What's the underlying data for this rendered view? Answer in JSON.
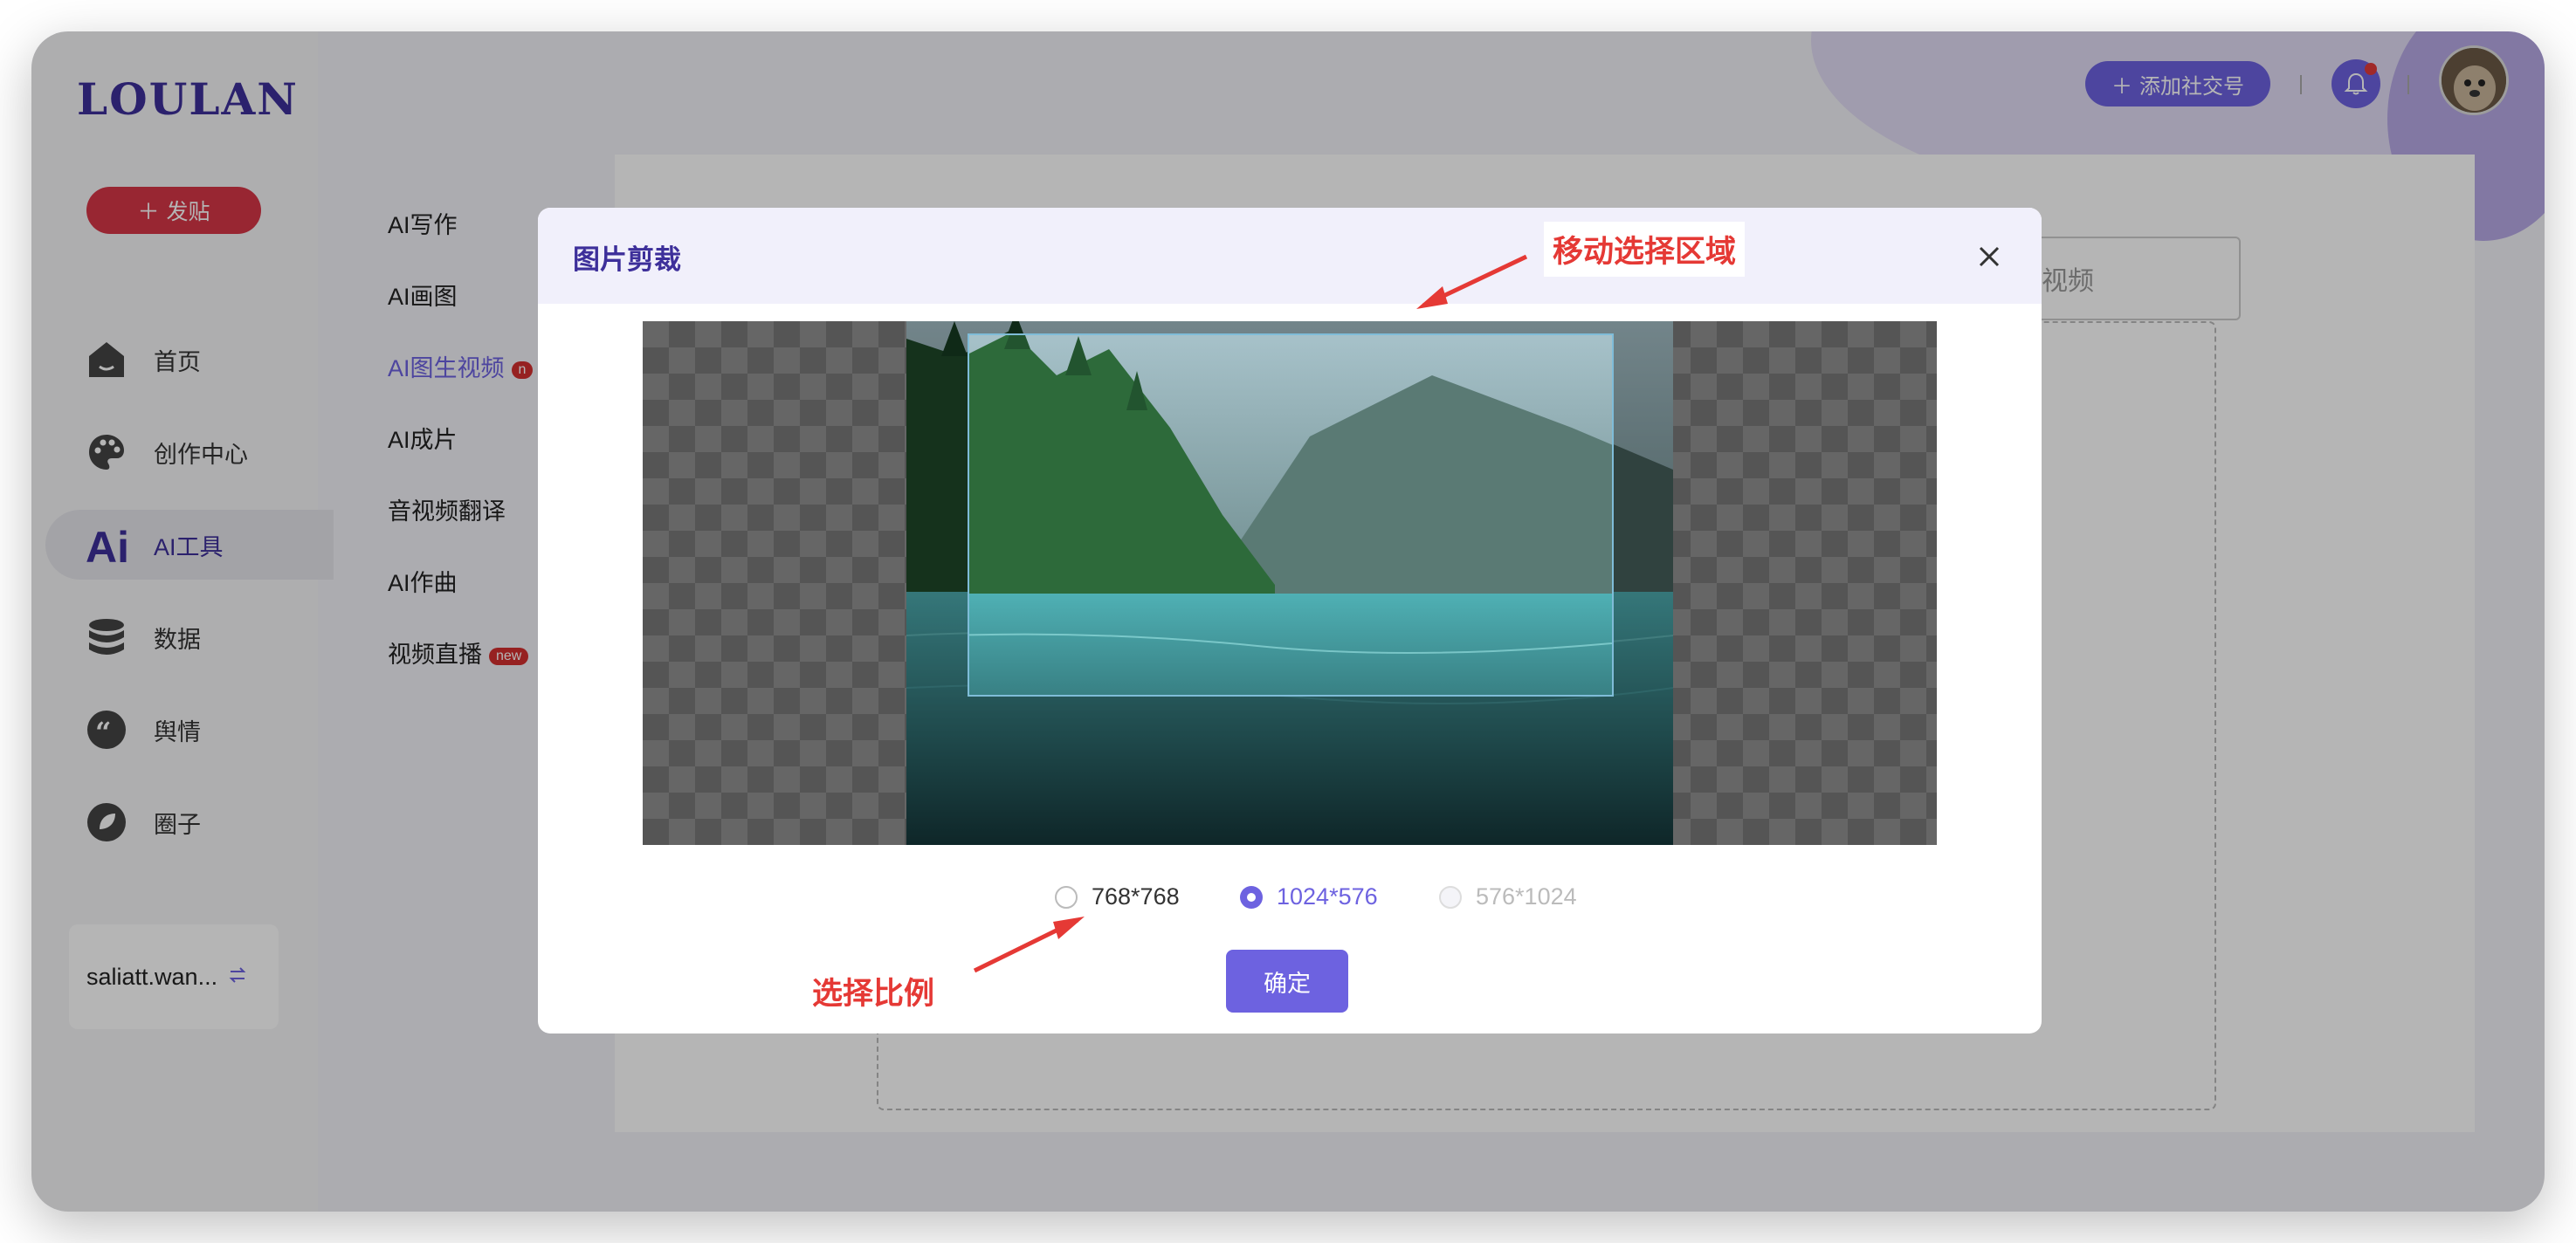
{
  "brand": {
    "logo": "LOULAN"
  },
  "sidebar": {
    "post_button": "发贴",
    "items": [
      {
        "label": "首页",
        "icon": "home-icon"
      },
      {
        "label": "创作中心",
        "icon": "palette-icon"
      },
      {
        "label": "AI工具",
        "icon": "ai-icon",
        "active": true
      },
      {
        "label": "数据",
        "icon": "database-icon"
      },
      {
        "label": "舆情",
        "icon": "quote-icon"
      },
      {
        "label": "圈子",
        "icon": "leaf-icon"
      }
    ],
    "user": {
      "name": "saliatt.wan..."
    }
  },
  "topbar": {
    "add_social": "添加社交号"
  },
  "submenu": {
    "items": [
      {
        "label": "AI写作"
      },
      {
        "label": "AI画图"
      },
      {
        "label": "AI图生视频",
        "active": true
      },
      {
        "label": "AI成片"
      },
      {
        "label": "音视频翻译"
      },
      {
        "label": "AI作曲"
      },
      {
        "label": "视频直播",
        "badge": "new"
      }
    ]
  },
  "background": {
    "right_tab": "视频"
  },
  "modal": {
    "title": "图片剪裁",
    "ratios": [
      {
        "label": "768*768",
        "state": "unchecked"
      },
      {
        "label": "1024*576",
        "state": "checked"
      },
      {
        "label": "576*1024",
        "state": "disabled"
      }
    ],
    "confirm": "确定"
  },
  "annotations": {
    "move_area": "移动选择区域",
    "select_ratio": "选择比例"
  },
  "colors": {
    "accent": "#6d62e0",
    "brand": "#3d2f9a",
    "danger": "#d63647",
    "annotation": "#e53935"
  }
}
